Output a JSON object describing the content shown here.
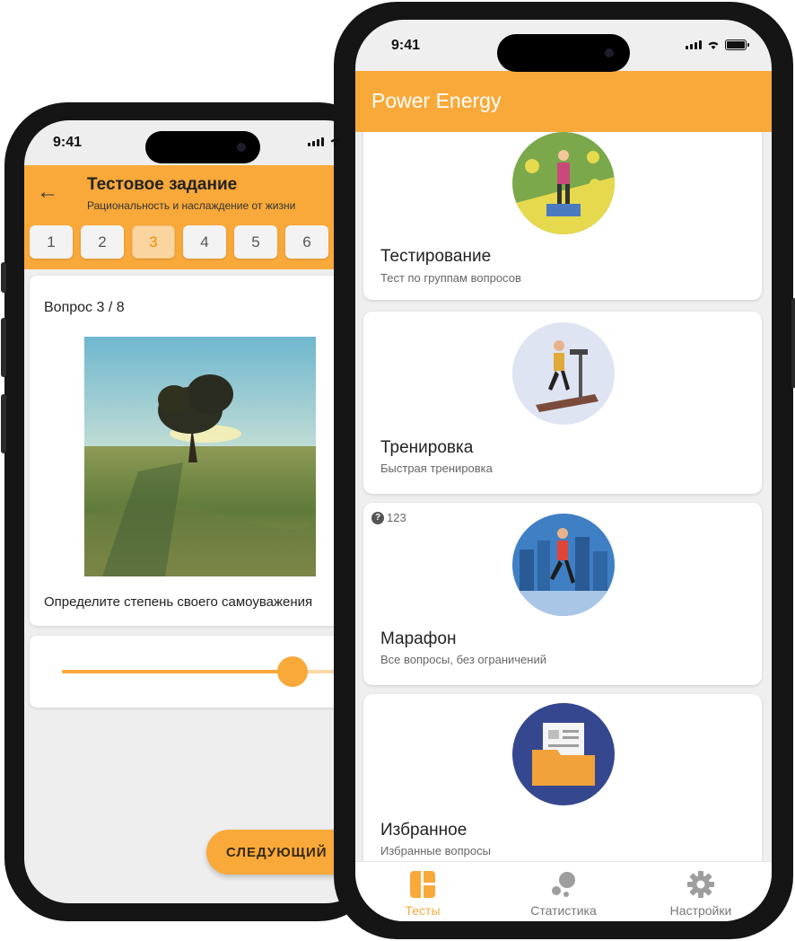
{
  "status_bar": {
    "time": "9:41"
  },
  "quiz_screen": {
    "title": "Тестовое задание",
    "subtitle": "Рациональность и наслаждение от жизни",
    "question_numbers": [
      "1",
      "2",
      "3",
      "4",
      "5",
      "6"
    ],
    "active_question": "3",
    "question_counter": "Вопрос 3 / 8",
    "question_text": "Определите степень своего самоуважения",
    "slider_value_fraction": 0.78,
    "next_button_label": "СЛЕДУЮЩИЙ"
  },
  "home_screen": {
    "app_title": "Power Energy",
    "cards": [
      {
        "title": "Тестирование",
        "subtitle": "Тест по группам вопросов",
        "icon": "testing-illustration"
      },
      {
        "title": "Тренировка",
        "subtitle": "Быстрая тренировка",
        "icon": "treadmill-illustration"
      },
      {
        "title": "Марафон",
        "subtitle": "Все вопросы, без ограничений",
        "badge": "123",
        "icon": "runner-illustration"
      },
      {
        "title": "Избранное",
        "subtitle": "Избранные вопросы",
        "icon": "folder-illustration"
      }
    ],
    "nav": [
      {
        "label": "Тесты",
        "active": true,
        "icon": "tests-icon"
      },
      {
        "label": "Статистика",
        "active": false,
        "icon": "statistics-icon"
      },
      {
        "label": "Настройки",
        "active": false,
        "icon": "settings-icon"
      }
    ]
  },
  "colors": {
    "accent": "#f8a93a",
    "background": "#eeeeee"
  }
}
